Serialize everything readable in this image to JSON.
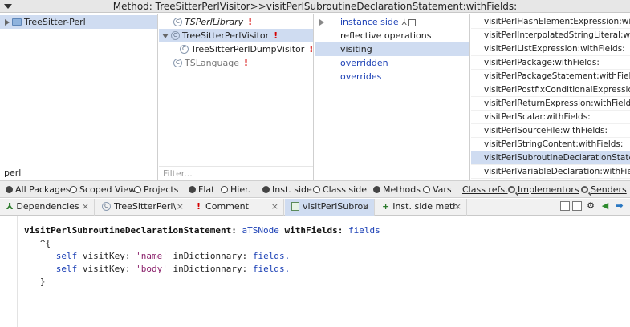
{
  "window": {
    "title": "Method: TreeSitterPerlVisitor>>visitPerlSubroutineDeclarationStatement:withFields:"
  },
  "packages": {
    "items": [
      {
        "label": "TreeSitter-Perl",
        "selected": true
      }
    ],
    "filter_value": "perl"
  },
  "classes": {
    "items": [
      {
        "label": "TSPerlLibrary",
        "italic": true,
        "warning": true
      },
      {
        "label": "TreeSitterPerlVisitor",
        "selected": true,
        "warning": true
      },
      {
        "label": "TreeSitterPerlDumpVisitor",
        "warning": true
      },
      {
        "label": "TSLanguage",
        "warning": true
      }
    ],
    "warning_mark": "!",
    "filter_placeholder": "Filter..."
  },
  "protocols": {
    "items": [
      {
        "label": "instance side"
      },
      {
        "label": "reflective operations"
      },
      {
        "label": "visiting",
        "selected": true
      },
      {
        "label": "overridden"
      },
      {
        "label": "overrides"
      }
    ]
  },
  "methods": {
    "items": [
      {
        "label": "visitPerlHashElementExpression:with"
      },
      {
        "label": "visitPerlInterpolatedStringLiteral:wi"
      },
      {
        "label": "visitPerlListExpression:withFields:"
      },
      {
        "label": "visitPerlPackage:withFields:"
      },
      {
        "label": "visitPerlPackageStatement:withFiel"
      },
      {
        "label": "visitPerlPostfixConditionalExpressio"
      },
      {
        "label": "visitPerlReturnExpression:withFields"
      },
      {
        "label": "visitPerlScalar:withFields:"
      },
      {
        "label": "visitPerlSourceFile:withFields:"
      },
      {
        "label": "visitPerlStringContent:withFields:"
      },
      {
        "label": "visitPerlSubroutineDeclarationState",
        "selected": true
      },
      {
        "label": "visitPerlVariableDeclaration:withFiel"
      }
    ]
  },
  "toolbar": {
    "all_packages": "All Packages",
    "scoped_view": "Scoped View",
    "projects": "Projects",
    "flat": "Flat",
    "hier": "Hier.",
    "inst_side": "Inst. side",
    "class_side": "Class side",
    "methods": "Methods",
    "vars": "Vars",
    "class_refs": "Class refs.",
    "implementors": "Implementors",
    "senders": "Senders"
  },
  "tabs": [
    {
      "label": "Dependencies",
      "close": "×"
    },
    {
      "label": "TreeSitterPerl\\",
      "close": "×"
    },
    {
      "label": "Comment",
      "close": "×"
    },
    {
      "label": "visitPerlSubrou",
      "close": "×",
      "active": true
    },
    {
      "label": "Inst. side meth",
      "close": "×"
    }
  ],
  "editor": {
    "line1_selector": "visitPerlSubroutineDeclarationStatement:",
    "line1_arg1": "aTSNode",
    "line1_kw2": "withFields:",
    "line1_arg2": "fields",
    "line2": "^{",
    "line3_self": "self",
    "line3_msg": "visitKey:",
    "line3_str": "'name'",
    "line3_kw": "inDictionnary:",
    "line3_var": "fields.",
    "line4_self": "self",
    "line4_msg": "visitKey:",
    "line4_str": "'body'",
    "line4_kw": "inDictionnary:",
    "line4_var": "fields.",
    "line5": "}"
  }
}
